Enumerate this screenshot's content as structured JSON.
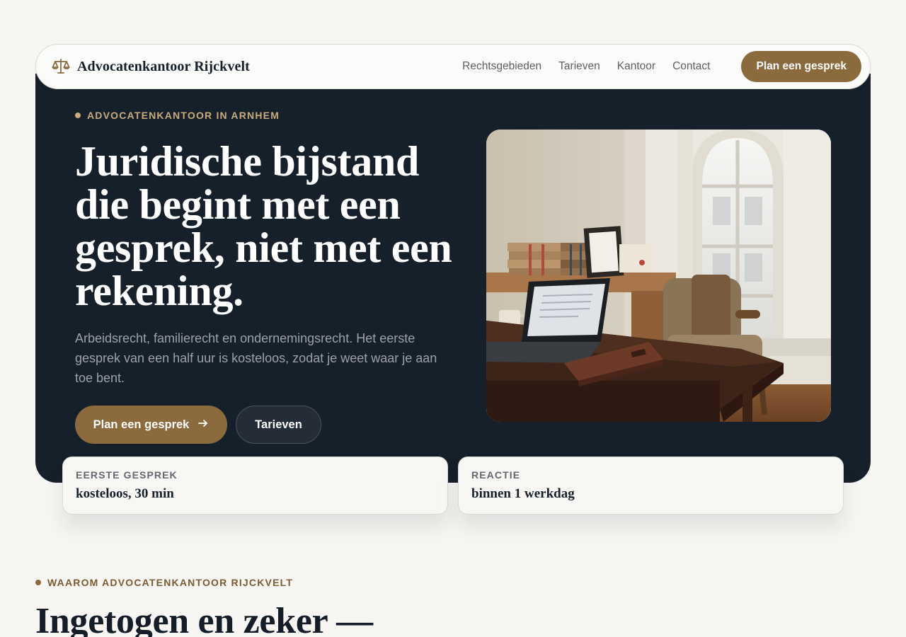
{
  "header": {
    "brand_name": "Advocatenkantoor Rijckvelt",
    "brand_icon": "scales-icon",
    "nav": [
      "Rechtsgebieden",
      "Tarieven",
      "Kantoor",
      "Contact"
    ],
    "cta_label": "Plan een gesprek"
  },
  "hero": {
    "eyebrow": "ADVOCATENKANTOOR IN ARNHEM",
    "title": "Juridische bijstand die begint met een gesprek, niet met een rekening.",
    "subtitle": "Arbeidsrecht, familierecht en ondernemingsrecht. Het eerste gesprek van een half uur is kosteloos, zodat je weet waar je aan toe bent.",
    "primary_button": "Plan een gesprek",
    "secondary_button": "Tarieven"
  },
  "cards": [
    {
      "label": "EERSTE GESPREK",
      "value": "kosteloos, 30 min"
    },
    {
      "label": "REACTIE",
      "value": "binnen 1 werkdag"
    }
  ],
  "why": {
    "eyebrow": "WAAROM ADVOCATENKANTOOR RIJCKVELT",
    "title": "Ingetogen en zeker —"
  },
  "colors": {
    "accent": "#8b6a3e",
    "hero_bg": "#16202b",
    "page_bg": "#f7f6f3",
    "eyebrow_gold": "#c9ab7c"
  }
}
